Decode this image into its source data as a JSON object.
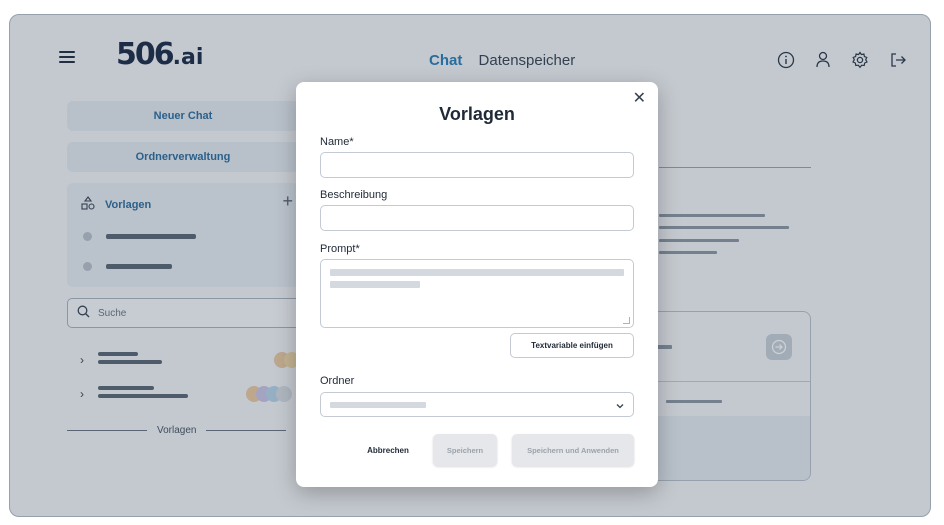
{
  "header": {
    "logo_text": "506",
    "logo_suffix": ".ai",
    "tabs": [
      {
        "label": "Chat",
        "active": true
      },
      {
        "label": "Datenspeicher",
        "active": false
      }
    ],
    "icons": [
      "info-icon",
      "user-icon",
      "settings-icon",
      "logout-icon"
    ]
  },
  "sidebar": {
    "new_chat_label": "Neuer Chat",
    "folder_mgmt_label": "Ordnerverwaltung",
    "templates_section_label": "Vorlagen",
    "search_placeholder": "Suche",
    "separator_label": "Vorlagen"
  },
  "modal": {
    "title": "Vorlagen",
    "name_label": "Name*",
    "description_label": "Beschreibung",
    "prompt_label": "Prompt*",
    "insert_variable_label": "Textvariable einfügen",
    "folder_label": "Ordner",
    "cancel_label": "Abbrechen",
    "save_label": "Speichern",
    "save_apply_label": "Speichern und Anwenden"
  },
  "colors": {
    "accent": "#2a7fb8",
    "dark": "#1e2d4a",
    "avatar_colors": [
      "#e9c9a3",
      "#f0d9a8",
      "#c9c5e6",
      "#b7d5ea",
      "#d8dde3"
    ]
  }
}
